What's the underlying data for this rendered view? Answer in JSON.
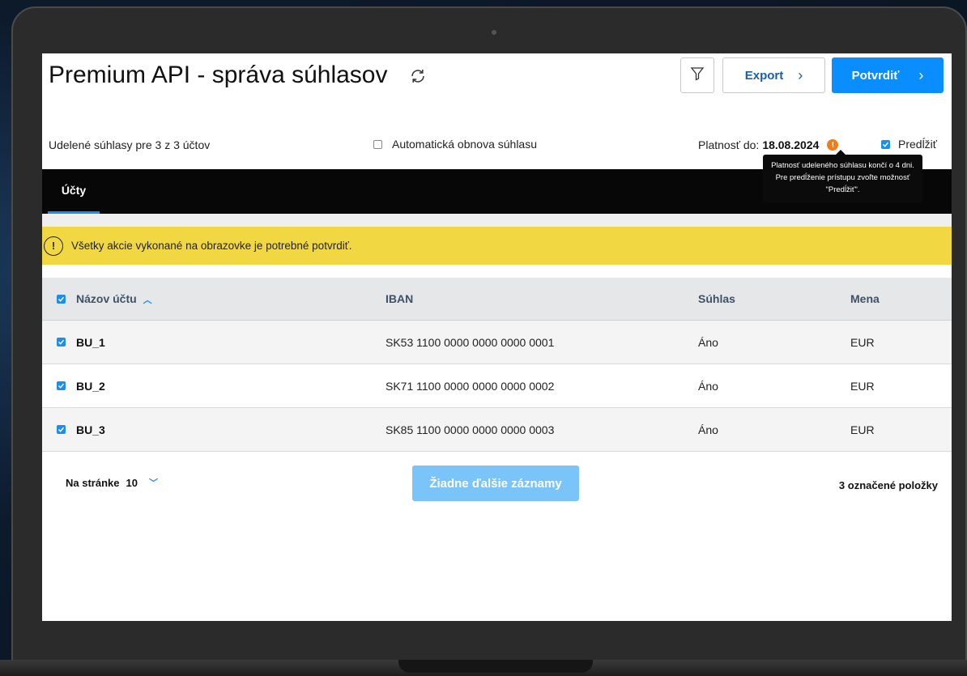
{
  "header": {
    "title": "Premium API - správa súhlasov",
    "export_label": "Export",
    "confirm_label": "Potvrdiť"
  },
  "info": {
    "summary": "Udelené súhlasy pre 3 z 3 účtov",
    "auto_renew_label": "Automatická obnova súhlasu",
    "auto_renew_checked": false,
    "validity_label": "Platnosť do:",
    "validity_date": "18.08.2024",
    "extend_label": "Predĺžiť",
    "extend_checked": true
  },
  "tooltip": {
    "text": "Platnosť udeleného súhlasu končí o 4 dni. Pre predĺženie prístupu zvoľte možnosť \"Predĺžiť\"."
  },
  "tabs": [
    {
      "label": "Účty",
      "active": true
    }
  ],
  "alert": {
    "icon": "!",
    "text": "Všetky akcie vykonané na obrazovke je potrebné potvrdiť."
  },
  "table": {
    "columns": [
      "Názov účtu",
      "IBAN",
      "Súhlas",
      "Mena"
    ],
    "rows": [
      {
        "name": "BU_1",
        "iban": "SK53 1100 0000 0000 0000 0001",
        "consent": "Áno",
        "currency": "EUR",
        "checked": true
      },
      {
        "name": "BU_2",
        "iban": "SK71 1100 0000 0000 0000 0002",
        "consent": "Áno",
        "currency": "EUR",
        "checked": true
      },
      {
        "name": "BU_3",
        "iban": "SK85 1100 0000 0000 0000 0003",
        "consent": "Áno",
        "currency": "EUR",
        "checked": true
      }
    ]
  },
  "footer": {
    "per_page_label": "Na stránke",
    "per_page_value": "10",
    "no_more_label": "Žiadne ďalšie záznamy",
    "selected_count": "3 označené položky"
  },
  "colors": {
    "accent": "#0a8dff",
    "alert_bg": "#f1d842",
    "warning_dot": "#f07d1c",
    "tab_bar": "#070707"
  },
  "icons": {
    "refresh": "refresh-icon",
    "filter": "filter-icon",
    "chevron": "chevron-right-icon",
    "warning": "warning-icon",
    "sort": "sort-ascending-icon"
  }
}
